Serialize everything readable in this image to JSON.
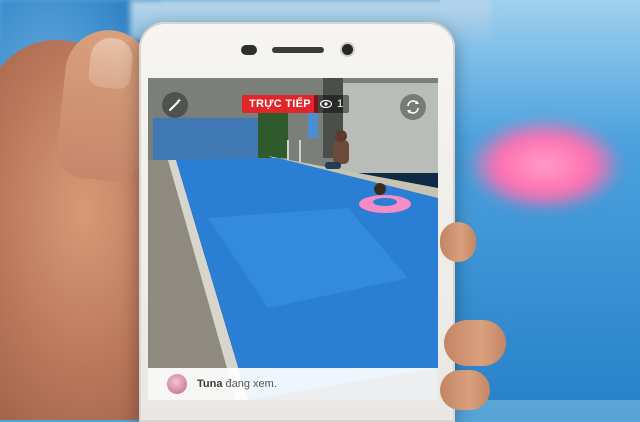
{
  "live": {
    "label": "TRỰC TIẾP",
    "viewers": "1"
  },
  "comment": {
    "user": "Tuna",
    "message": "đang xem."
  },
  "icons": {
    "magic": "magic-wand-icon",
    "switch_camera": "switch-camera-icon",
    "viewer": "eye-icon"
  },
  "colors": {
    "live_badge": "#e1262b",
    "pool_water": "#2a7fd4"
  }
}
